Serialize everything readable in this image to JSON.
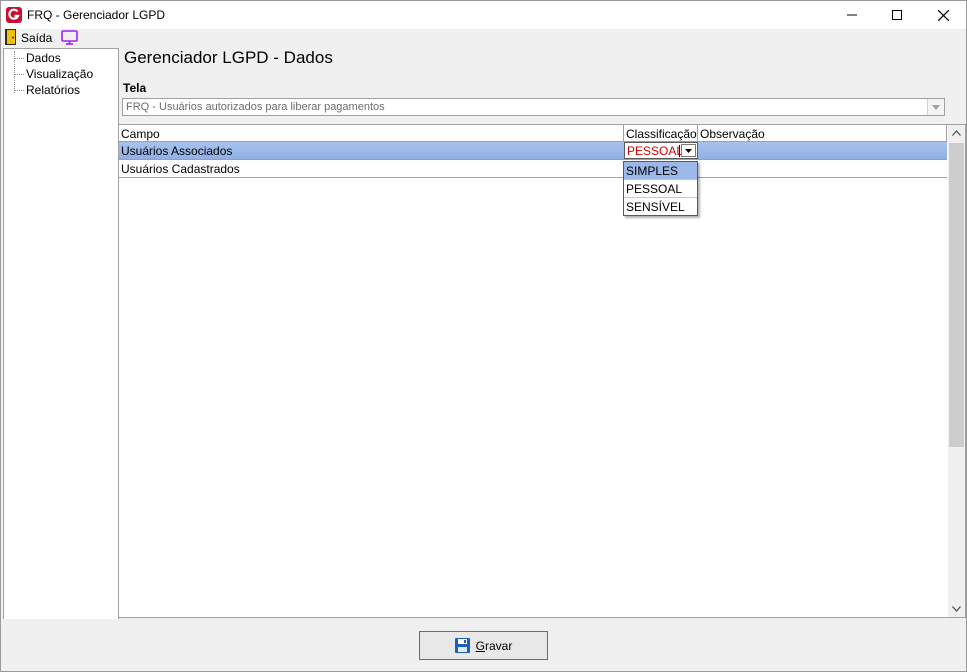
{
  "window": {
    "title": "FRQ - Gerenciador LGPD",
    "minimize_label": "—",
    "maximize_label": "☐",
    "close_label": "✕"
  },
  "menu": {
    "exit_label": "Saída"
  },
  "tree": {
    "items": [
      {
        "label": "Dados"
      },
      {
        "label": "Visualização"
      },
      {
        "label": "Relatórios"
      }
    ]
  },
  "main": {
    "title": "Gerenciador LGPD - Dados",
    "tela_label": "Tela",
    "tela_value": "FRQ - Usuários autorizados para liberar pagamentos"
  },
  "grid": {
    "columns": [
      "Campo",
      "Classificação",
      "Observação"
    ],
    "rows": [
      {
        "campo": "Usuários Associados",
        "classificacao": "PESSOAL",
        "observacao": ""
      },
      {
        "campo": "Usuários Cadastrados",
        "classificacao": "",
        "observacao": ""
      }
    ],
    "dropdown_options": [
      "SIMPLES",
      "PESSOAL",
      "SENSÍVEL"
    ],
    "highlighted_option": "SIMPLES"
  },
  "footer": {
    "save_label": "Gravar"
  },
  "colors": {
    "selection": "#9cb8e8",
    "edit_text": "#cc0000",
    "app_icon": "#c8102e"
  }
}
